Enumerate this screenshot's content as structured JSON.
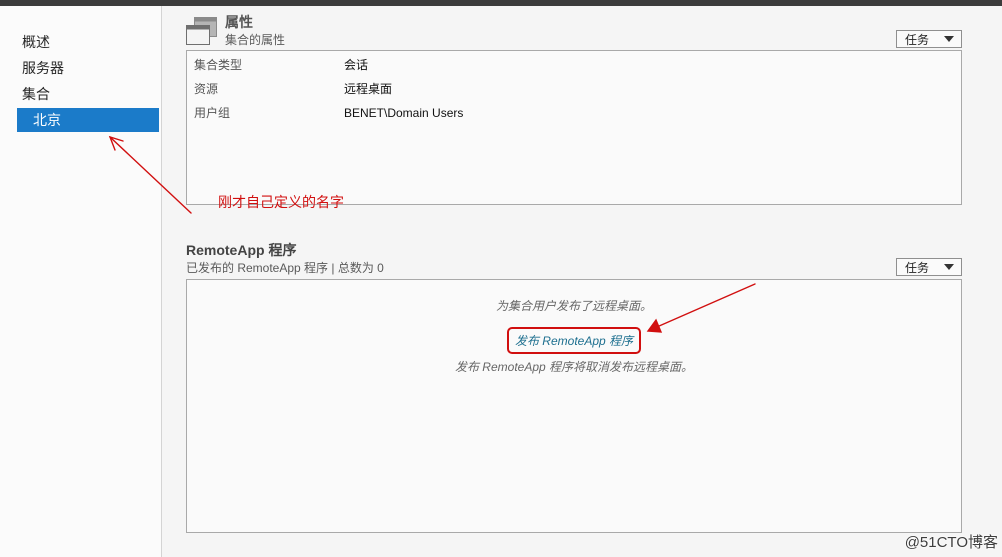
{
  "colors": {
    "selected_item_bg": "#1b7bc9",
    "link": "#1d6f8f",
    "annotation": "#d10f0f",
    "top_bar": "#3c3c3c"
  },
  "sidebar": {
    "items": [
      {
        "label": "概述"
      },
      {
        "label": "服务器"
      },
      {
        "label": "集合"
      },
      {
        "label": "北京",
        "selected": true
      }
    ]
  },
  "properties": {
    "icon": "window-icon",
    "title": "属性",
    "subtitle": "集合的属性",
    "tasks_label": "任务",
    "tasks_icon": "chevron-down-icon",
    "rows": [
      {
        "key": "集合类型",
        "value": "会话"
      },
      {
        "key": "资源",
        "value": "远程桌面"
      },
      {
        "key": "用户组",
        "value": "BENET\\Domain Users"
      }
    ]
  },
  "remoteapp": {
    "title": "RemoteApp 程序",
    "subtitle": "已发布的 RemoteApp 程序 | 总数为 0",
    "tasks_label": "任务",
    "tasks_icon": "chevron-down-icon",
    "message": "为集合用户发布了远程桌面。",
    "publish_link": "发布 RemoteApp 程序",
    "note": "发布 RemoteApp 程序将取消发布远程桌面。"
  },
  "annotations": {
    "label": "刚才自己定义的名字"
  },
  "watermark": "@51CTO博客"
}
